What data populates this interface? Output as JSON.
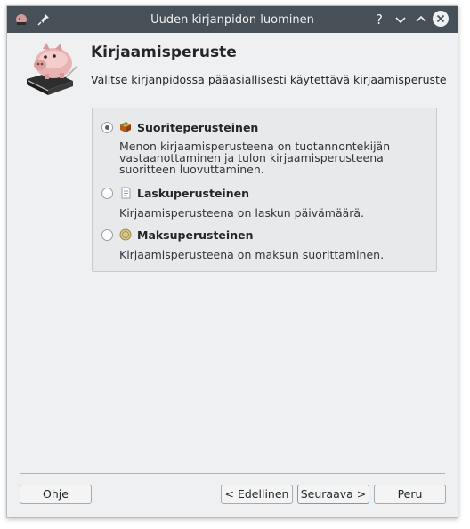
{
  "window": {
    "title": "Uuden kirjanpidon luominen",
    "titlebar_buttons": [
      "help-icon",
      "minimize-icon",
      "maximize-icon",
      "close-icon"
    ]
  },
  "page": {
    "heading": "Kirjaamisperuste",
    "subtitle": "Valitse kirjanpidossa pääasiallisesti käytettävä kirjaamisperuste"
  },
  "options": [
    {
      "label": "Suoriteperusteinen",
      "selected": true,
      "icon": "box-icon",
      "description": "Menon kirjaamisperusteena on tuotannontekijän vastaanottaminen ja tulon kirjaamisperusteena suoritteen luovuttaminen."
    },
    {
      "label": "Laskuperusteinen",
      "selected": false,
      "icon": "invoice-icon",
      "description": "Kirjaamisperusteena on laskun päivämäärä."
    },
    {
      "label": "Maksuperusteinen",
      "selected": false,
      "icon": "coin-icon",
      "description": "Kirjaamisperusteena on maksun suorittaminen."
    }
  ],
  "buttons": {
    "help": "Ohje",
    "back": "< Edellinen",
    "next": "Seuraava >",
    "cancel": "Peru"
  },
  "colors": {
    "titlebar": "#475057",
    "window_bg": "#eff0f1",
    "focus_accent": "#3daee9"
  }
}
